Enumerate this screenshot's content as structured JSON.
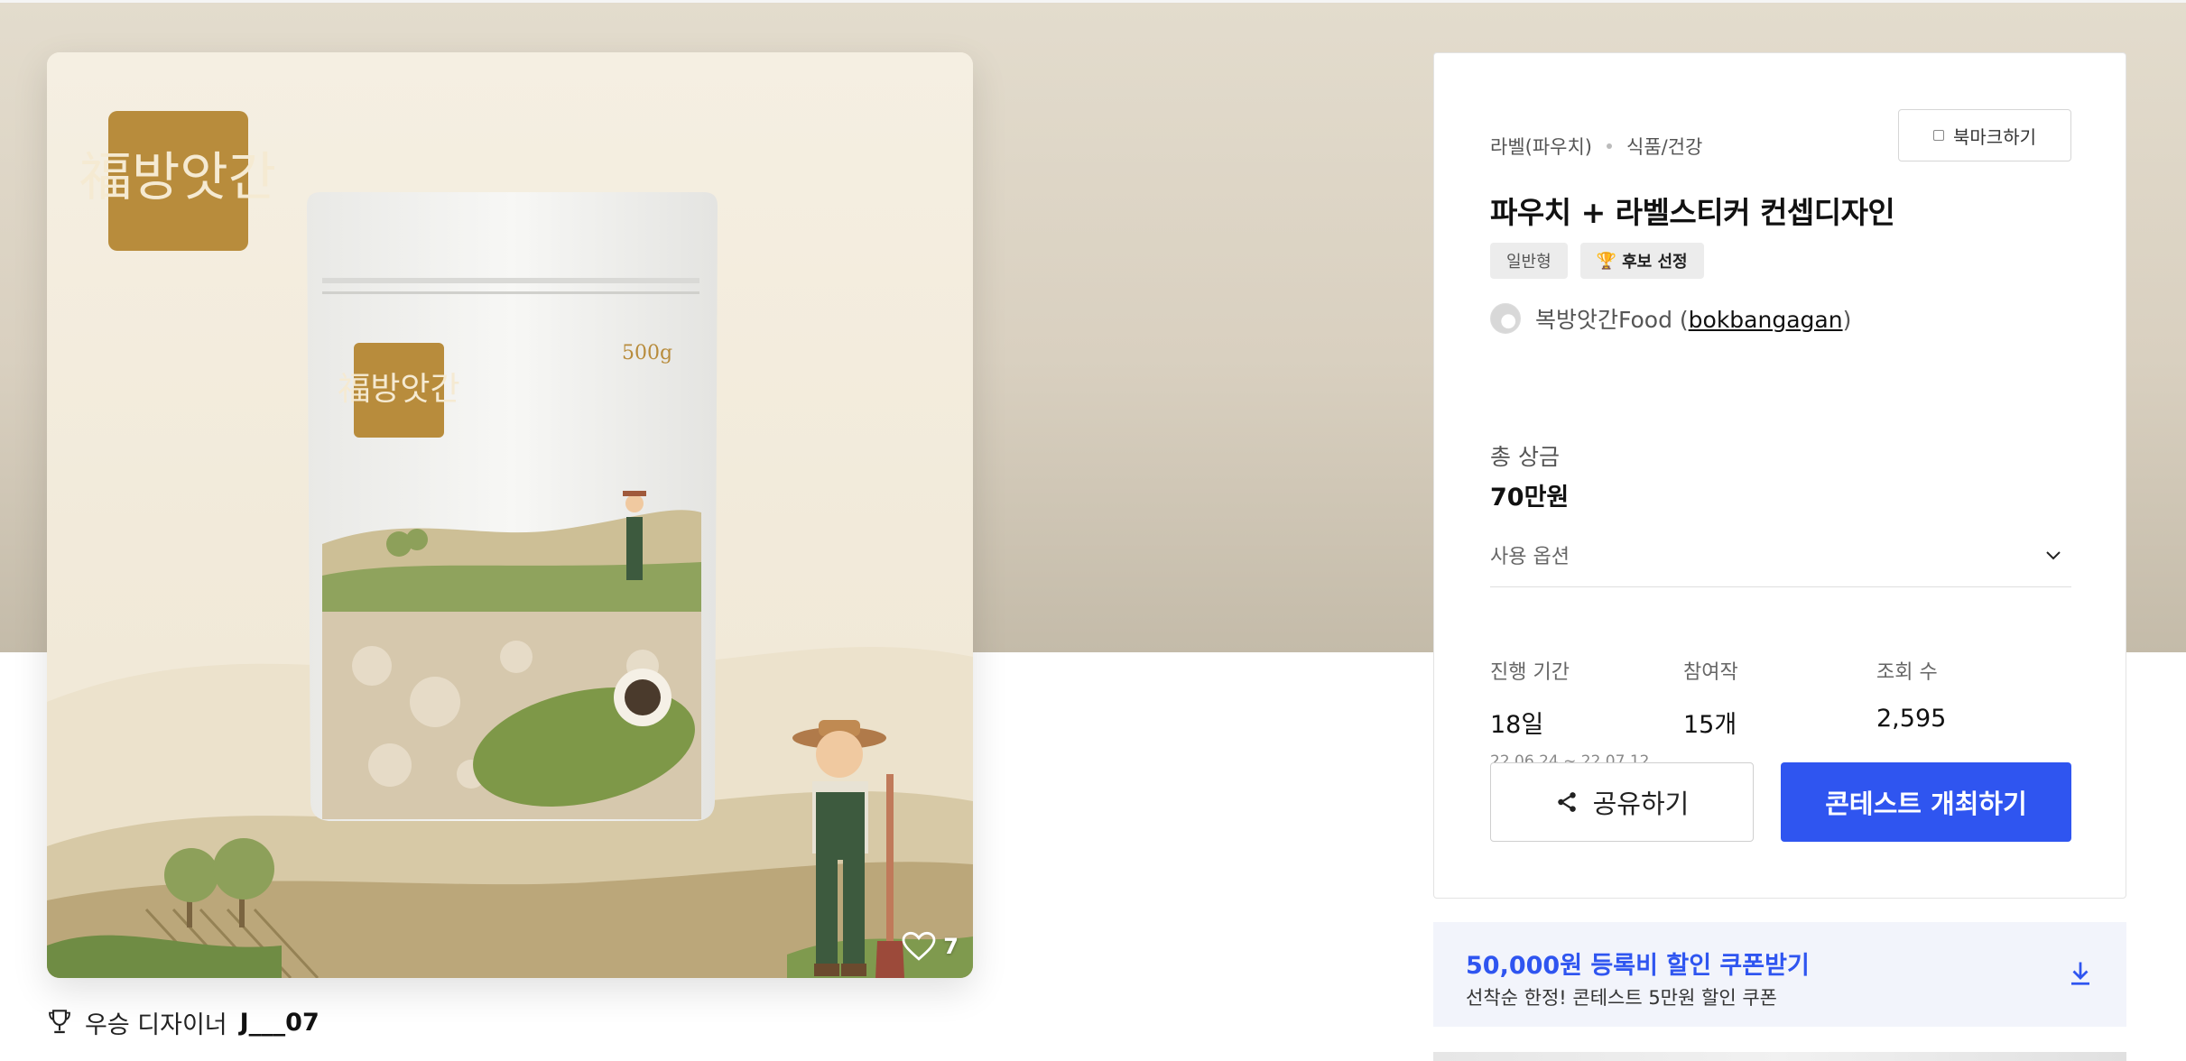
{
  "image": {
    "logo_text": "福방앗간",
    "package_weight": "500g",
    "like_count": "7"
  },
  "winner": {
    "label": "우승 디자이너",
    "name": "J___07"
  },
  "info": {
    "breadcrumb": [
      "라벨(파우치)",
      "식품/건강"
    ],
    "bookmark_label": "북마크하기",
    "title": "파우치 + 라벨스티커 컨셉디자인",
    "tags": [
      "일반형",
      "후보 선정"
    ],
    "host_name": "복방앗간Food",
    "host_id": "bokbangagan",
    "prize_label": "총 상금",
    "prize_value": "70만원",
    "usage_label": "사용 옵션",
    "stats": [
      {
        "label": "진행 기간",
        "value": "18일",
        "sub": "22.06.24 ~ 22.07.12"
      },
      {
        "label": "참여작",
        "value": "15개"
      },
      {
        "label": "조회 수",
        "value": "2,595"
      }
    ],
    "share_label": "공유하기",
    "host_button_label": "콘테스트 개최하기"
  },
  "coupon": {
    "title": "50,000원 등록비 할인 쿠폰받기",
    "subtitle": "선착순 한정! 콘테스트 5만원 할인 쿠폰"
  },
  "colors": {
    "accent": "#2f55f0",
    "hero_bg": "#dcd4c5",
    "coupon_bg": "#f2f4fb"
  }
}
